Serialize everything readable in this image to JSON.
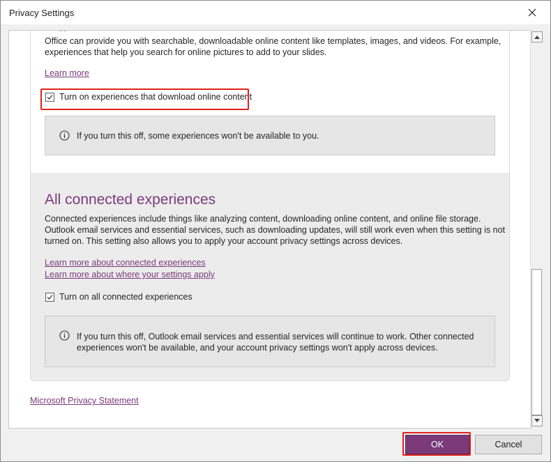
{
  "window": {
    "title": "Privacy Settings"
  },
  "section1": {
    "description_line1": "Office can provide you with searchable, downloadable online content like templates, images, and videos. For example,",
    "description_line2": "experiences that help you search for online pictures to add to your slides.",
    "learn_more": "Learn more",
    "checkbox_label": "Turn on experiences that download online content",
    "checkbox_checked": true,
    "info_text": "If you turn this off, some experiences won't be available to you."
  },
  "section2": {
    "heading": "All connected experiences",
    "description_line1": "Connected experiences include things like analyzing content, downloading online content, and online file storage.",
    "description_line2": "Outlook email services and essential services, such as downloading updates, will still work even when this setting is not",
    "description_line3": "turned on. This setting also allows you to apply your account privacy settings across devices.",
    "link1": "Learn more about connected experiences",
    "link2": "Learn more about where your settings apply",
    "checkbox_label": "Turn on all connected experiences",
    "checkbox_checked": true,
    "info_line1": "If you turn this off, Outlook email services and essential services will continue to work. Other connected",
    "info_line2": "experiences won't be available, and your account privacy settings won't apply across devices."
  },
  "privacy_link": "Microsoft Privacy Statement",
  "buttons": {
    "ok": "OK",
    "cancel": "Cancel"
  },
  "colors": {
    "accent": "#7a3a7a",
    "highlight": "#e0201b"
  },
  "icons": [
    "close-icon",
    "checkmark-icon",
    "info-icon",
    "scroll-up-icon",
    "scroll-down-icon"
  ]
}
